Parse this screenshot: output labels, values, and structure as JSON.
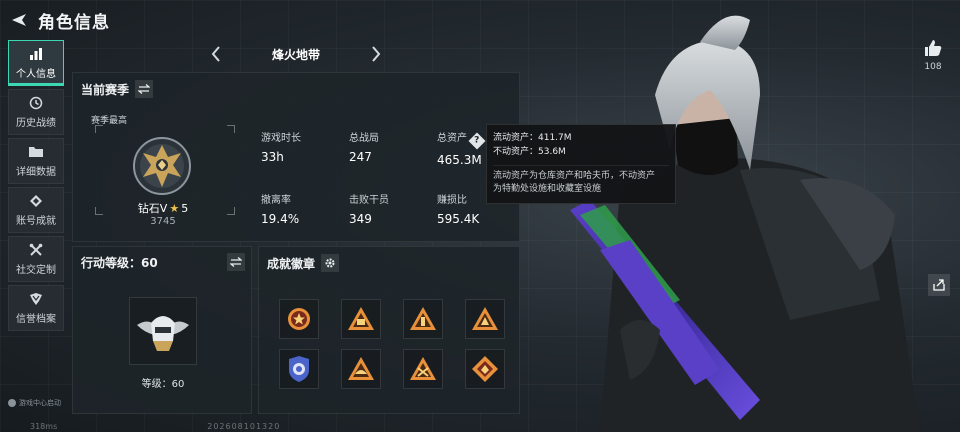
{
  "header": {
    "title": "角色信息"
  },
  "sidebar": {
    "items": [
      {
        "label": "个人信息",
        "icon": "bar-chart-icon",
        "active": true
      },
      {
        "label": "历史战绩",
        "icon": "history-icon"
      },
      {
        "label": "详细数据",
        "icon": "folder-icon"
      },
      {
        "label": "账号成就",
        "icon": "achievement-icon"
      },
      {
        "label": "社交定制",
        "icon": "tools-icon"
      },
      {
        "label": "信誉档案",
        "icon": "shield-icon"
      }
    ],
    "footer_note": "游戏中心启动"
  },
  "mode": {
    "name": "烽火地带"
  },
  "season": {
    "title": "当前赛季",
    "best_label": "赛季最高",
    "rank_name": "钻石V",
    "rank_stars": "5",
    "rank_score": "3745",
    "stats": [
      {
        "label": "游戏时长",
        "value": "33h"
      },
      {
        "label": "总战局",
        "value": "247"
      },
      {
        "label": "总资产",
        "value": "465.3M"
      },
      {
        "label": "撤离率",
        "value": "19.4%"
      },
      {
        "label": "击败干员",
        "value": "349"
      },
      {
        "label": "赚损比",
        "value": "595.4K"
      }
    ]
  },
  "tooltip": {
    "liquid": "流动资产：411.7M",
    "fixed": "不动资产：53.6M",
    "desc_line1": "流动资产为仓库资产和哈夫币，不动资产",
    "desc_line2": "为特勤处设施和收藏室设施"
  },
  "level": {
    "title": "行动等级：60",
    "level_text": "等级：60"
  },
  "achievements": {
    "title": "成就徽章",
    "badges": [
      "badge-1",
      "badge-2",
      "badge-3",
      "badge-4",
      "badge-5",
      "badge-6",
      "badge-7",
      "badge-8"
    ]
  },
  "likes": {
    "count": "108"
  },
  "bottom": {
    "ping": "318ms",
    "uid": "202608101320"
  },
  "colors": {
    "accent": "#3dd7b3",
    "gold": "#c9a45a",
    "star": "#f0c04d",
    "badge_orange": "#e8913a"
  }
}
